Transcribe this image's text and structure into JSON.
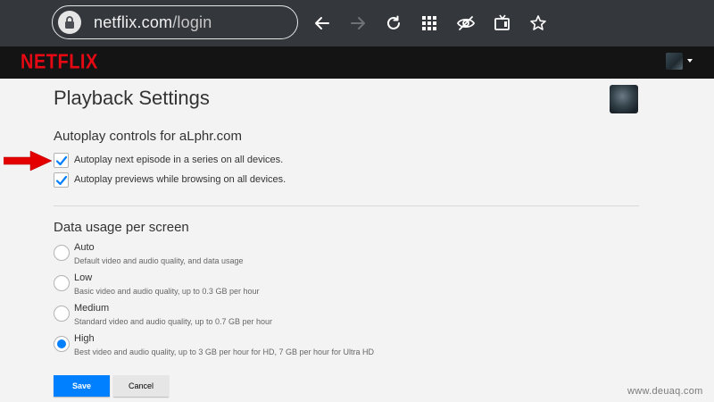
{
  "browser": {
    "url_host": "netflix.com",
    "url_path": "/login",
    "lock_icon": "lock-icon",
    "nav_icons": [
      "back-arrow-icon",
      "forward-arrow-icon",
      "reload-icon",
      "grid-apps-icon",
      "eye-slash-icon",
      "tv-icon",
      "star-icon"
    ]
  },
  "header": {
    "logo_text": "NETFLIX",
    "brand_color": "#e50914"
  },
  "page": {
    "title": "Playback Settings",
    "autoplay": {
      "title": "Autoplay controls for aLphr.com",
      "options": [
        {
          "label": "Autoplay next episode in a series on all devices.",
          "checked": true
        },
        {
          "label": "Autoplay previews while browsing on all devices.",
          "checked": true
        }
      ]
    },
    "data_usage": {
      "title": "Data usage per screen",
      "selected": "High",
      "options": [
        {
          "label": "Auto",
          "desc": "Default video and audio quality, and data usage",
          "selected": false
        },
        {
          "label": "Low",
          "desc": "Basic video and audio quality, up to 0.3 GB per hour",
          "selected": false
        },
        {
          "label": "Medium",
          "desc": "Standard video and audio quality, up to 0.7 GB per hour",
          "selected": false
        },
        {
          "label": "High",
          "desc": "Best video and audio quality, up to 3 GB per hour for HD, 7 GB per hour for Ultra HD",
          "selected": true
        }
      ]
    },
    "buttons": {
      "save": "Save",
      "cancel": "Cancel"
    },
    "accent_color": "#0080ff"
  },
  "watermark": "www.deuaq.com"
}
